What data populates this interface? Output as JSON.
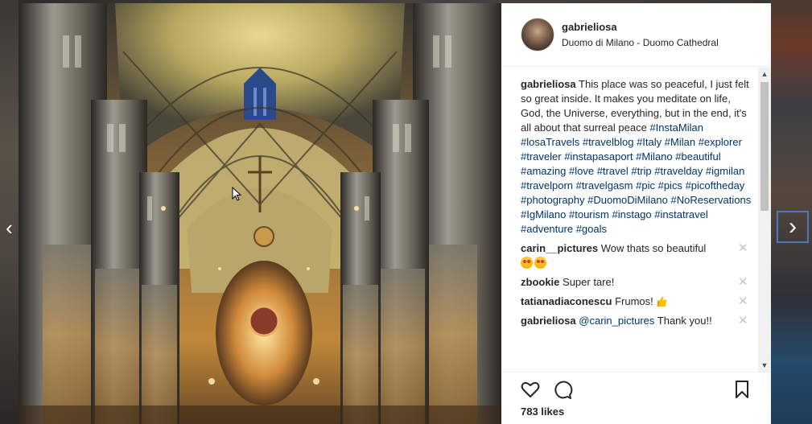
{
  "post": {
    "username": "gabrieliosa",
    "location": "Duomo di Milano - Duomo Cathedral",
    "caption_text": "This place was so peaceful, I just felt so great inside. It makes you meditate on life, God, the Universe, everything, but in the end, it's all about that surreal peace",
    "hashtags": [
      "#InstaMilan",
      "#losaTravels",
      "#travelblog",
      "#Italy",
      "#Milan",
      "#explorer",
      "#traveler",
      "#instapasaport",
      "#Milano",
      "#beautiful",
      "#amazing",
      "#love",
      "#travel",
      "#trip",
      "#travelday",
      "#igmilan",
      "#travelporn",
      "#travelgasm",
      "#pic",
      "#pics",
      "#picoftheday",
      "#photography",
      "#DuomoDiMilano",
      "#NoReservations",
      "#IgMilano",
      "#tourism",
      "#instago",
      "#instatravel",
      "#adventure",
      "#goals"
    ],
    "likes": "783 likes"
  },
  "comments": [
    {
      "user": "carin__pictures",
      "text": "Wow thats so beautiful",
      "emoji": "heart-eyes-emoji x2"
    },
    {
      "user": "zbookie",
      "text": "Super tare!"
    },
    {
      "user": "tatianadiaconescu",
      "text": "Frumos!",
      "emoji": "thumbs-up-emoji"
    },
    {
      "user": "gabrieliosa",
      "mention": "@carin_pictures",
      "text": "Thank you!!"
    }
  ],
  "icons": {
    "like": "heart-icon",
    "comment": "comment-bubble-icon",
    "save": "bookmark-icon",
    "prev": "chevron-left-icon",
    "next": "chevron-right-icon",
    "delete": "close-icon"
  },
  "colors": {
    "hashtag": "#003569",
    "text": "#262626",
    "nav_focus": "#4a78c0"
  }
}
